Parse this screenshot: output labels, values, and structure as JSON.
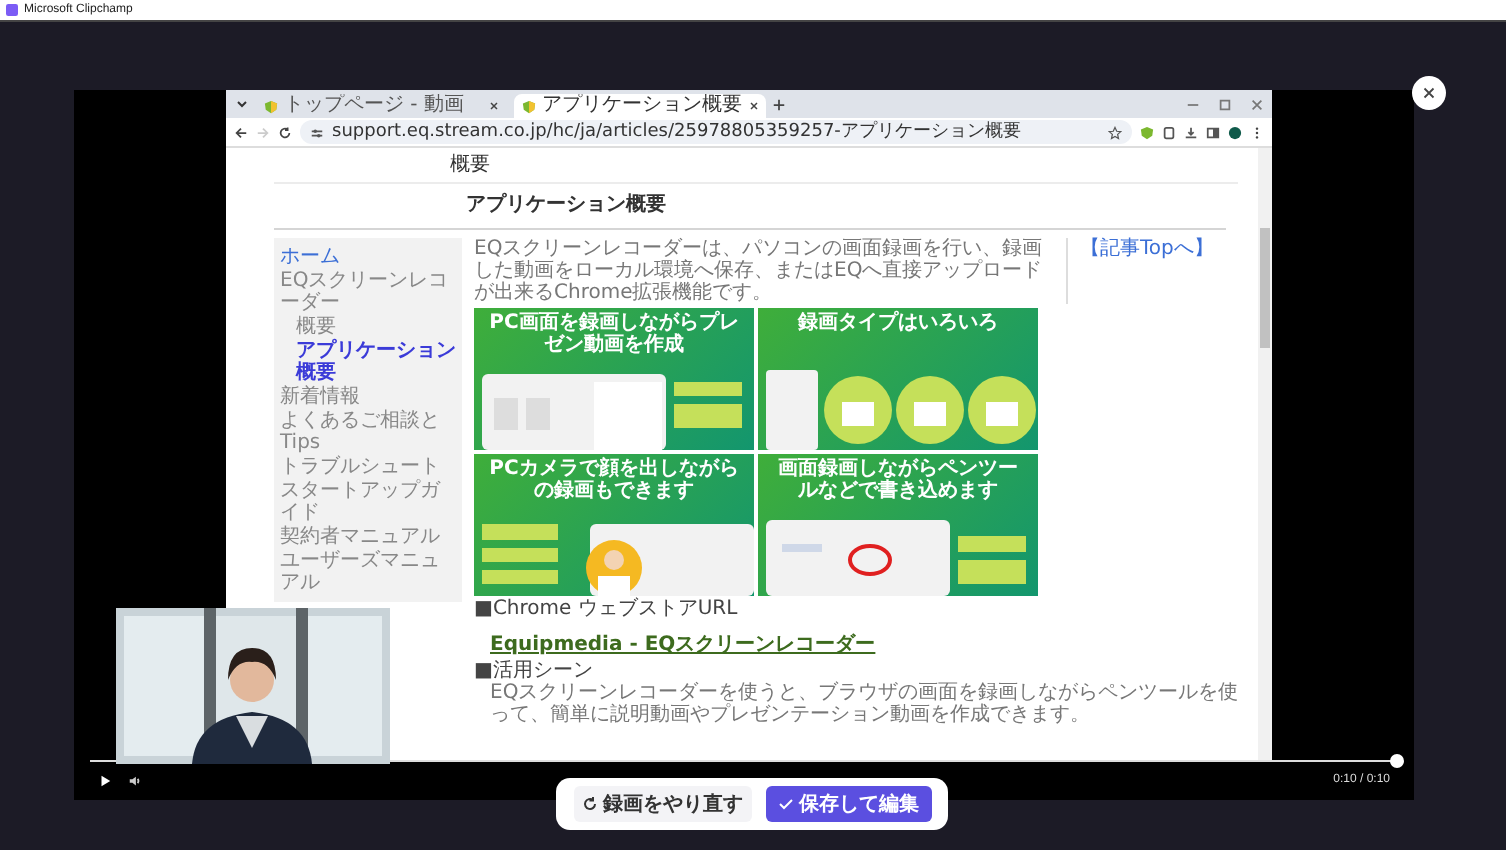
{
  "app": {
    "title": "Microsoft Clipchamp"
  },
  "browser": {
    "tabs": [
      {
        "label": "トップページ - 動画",
        "selected": false
      },
      {
        "label": "アプリケーション概要",
        "selected": true
      }
    ],
    "url": "support.eq.stream.co.jp/hc/ja/articles/25978805359257-アプリケーション概要"
  },
  "page": {
    "heading": "概要",
    "subheading": "アプリケーション概要",
    "sidebar": {
      "home": "ホーム",
      "items": [
        {
          "label": "EQスクリーンレコーダー",
          "selected": false,
          "children": [
            {
              "label": "概要",
              "selected": false
            },
            {
              "label": "アプリケーション概要",
              "selected": true
            }
          ]
        },
        {
          "label": "新着情報",
          "selected": false
        },
        {
          "label": "よくあるご相談とTips",
          "selected": false
        },
        {
          "label": "トラブルシュート",
          "selected": false
        },
        {
          "label": "スタートアップガイド",
          "selected": false
        },
        {
          "label": "契約者マニュアル",
          "selected": false
        },
        {
          "label": "ユーザーズマニュアル",
          "selected": false
        }
      ]
    },
    "intro": "EQスクリーンレコーダーは、パソコンの画面録画を行い、録画した動画をローカル環境へ保存、またはEQへ直接アップロードが出来るChrome拡張機能です。",
    "top_link": "【記事Topへ】",
    "panels": [
      {
        "kind": "browser",
        "heading": "PC画面を録画しながらプレゼン動画を作成"
      },
      {
        "kind": "types",
        "heading": "録画タイプはいろいろ"
      },
      {
        "kind": "camera",
        "heading": "PCカメラで顔を出しながらの録画もできます"
      },
      {
        "kind": "pen",
        "heading": "画面録画しながらペンツールなどで書き込めます"
      }
    ],
    "store_label": "■Chrome ウェブストアURL",
    "store_link": "Equipmedia - EQスクリーンレコーダー",
    "usage_label": "■活用シーン",
    "usage_text": "EQスクリーンレコーダーを使うと、ブラウザの画面を録画しながらペンツールを使って、簡単に説明動画やプレゼンテーション動画を作成できます。"
  },
  "player": {
    "progress": {
      "level": 1
    },
    "time": "0:10 / 0:10"
  },
  "actions": [
    {
      "kind": "retake",
      "label": "録画をやり直す"
    },
    {
      "kind": "save",
      "label": "保存して編集"
    }
  ]
}
